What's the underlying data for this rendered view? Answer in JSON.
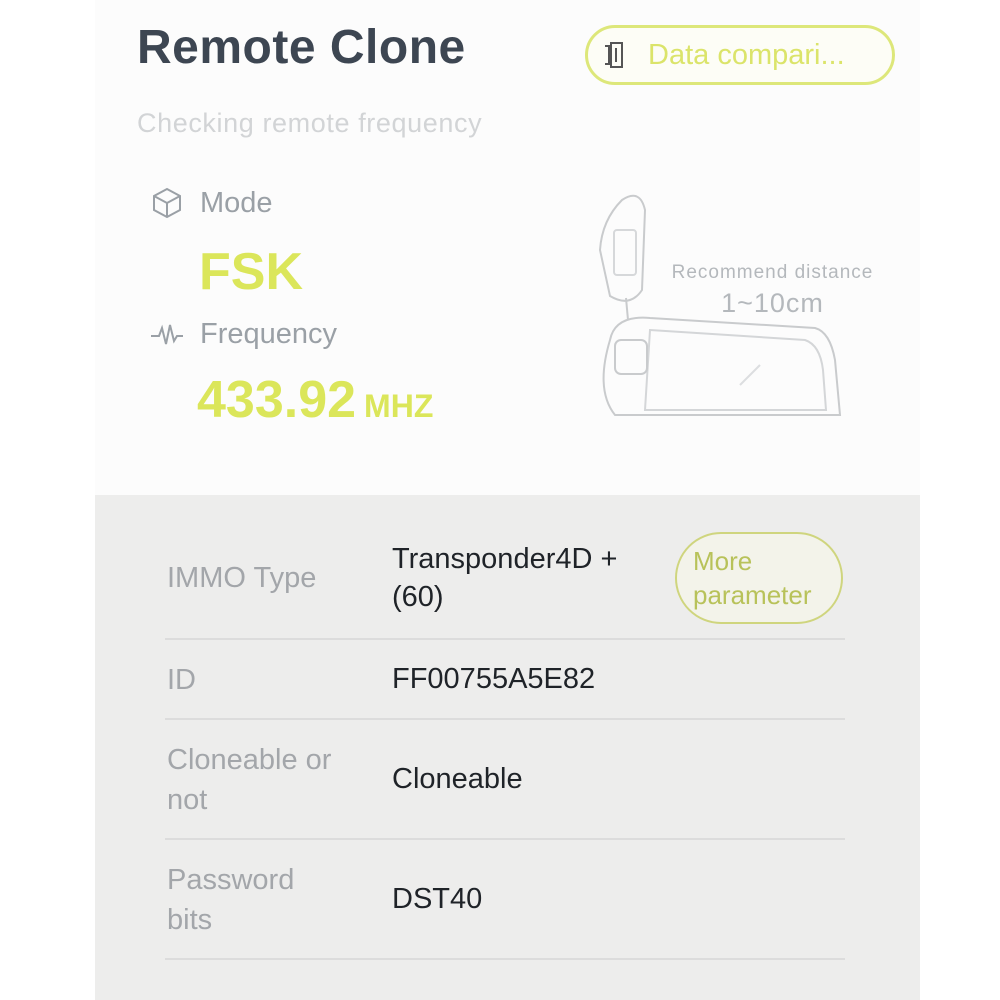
{
  "header": {
    "title": "Remote Clone",
    "data_compare_label": "Data compari...",
    "subtitle": "Checking remote frequency"
  },
  "signal": {
    "mode_label": "Mode",
    "mode_value": "FSK",
    "frequency_label": "Frequency",
    "frequency_value": "433.92",
    "frequency_unit": "MHZ"
  },
  "illustration": {
    "distance_label": "Recommend distance",
    "distance_value": "1~10cm"
  },
  "info": {
    "more_parameter_label": "More parameter",
    "rows": [
      {
        "key": "IMMO Type",
        "value": "Transponder4D +(60)"
      },
      {
        "key": "ID",
        "value": "FF00755A5E82"
      },
      {
        "key": "Cloneable or not",
        "value": "Cloneable"
      },
      {
        "key": "Password bits",
        "value": "DST40"
      }
    ]
  },
  "colors": {
    "accent": "#dbe65a",
    "title": "#3d4652",
    "label": "#9aa0a6",
    "panel_bg": "#ededec"
  },
  "icons": {
    "data_compare": "sim-card-icon",
    "mode": "cube-icon",
    "frequency": "waveform-icon"
  }
}
